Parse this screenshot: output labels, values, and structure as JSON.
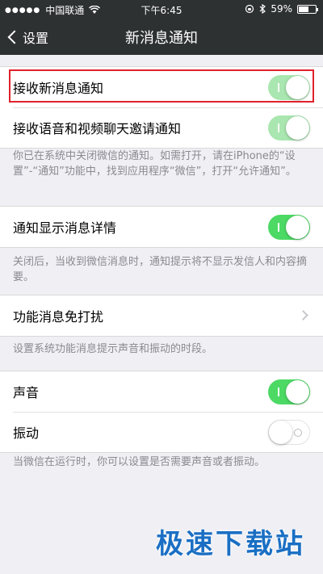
{
  "status": {
    "carrier": "中国联通",
    "time": "下午6:45",
    "battery": "59%",
    "battery_level": 0.59
  },
  "nav": {
    "back_label": "设置",
    "title": "新消息通知"
  },
  "group1": {
    "row1": {
      "label": "接收新消息通知",
      "switch_state": "on"
    },
    "row2": {
      "label": "接收语音和视频聊天邀请通知",
      "switch_state": "on"
    }
  },
  "note1": "你已在系统中关闭微信的通知。如需打开，请在iPhone的“设置”-“通知”功能中，找到应用程序“微信”，打开“允许通知”。",
  "group2": {
    "row1": {
      "label": "通知显示消息详情",
      "switch_state": "on"
    }
  },
  "note2": "关闭后，当收到微信消息时，通知提示将不显示发信人和内容摘要。",
  "group3": {
    "row1": {
      "label": "功能消息免打扰"
    }
  },
  "note3": "设置系统功能消息提示声音和振动的时段。",
  "group4": {
    "row1": {
      "label": "声音",
      "switch_state": "on"
    },
    "row2": {
      "label": "振动",
      "switch_state": "off"
    }
  },
  "note4": "当微信在运行时，你可以设置是否需要声音或者振动。",
  "watermark": "极速下载站",
  "colors": {
    "nav_bg": "#2e3132",
    "switch_on": "#4cd964",
    "highlight": "#e0222a",
    "watermark": "#1a6fc4"
  }
}
